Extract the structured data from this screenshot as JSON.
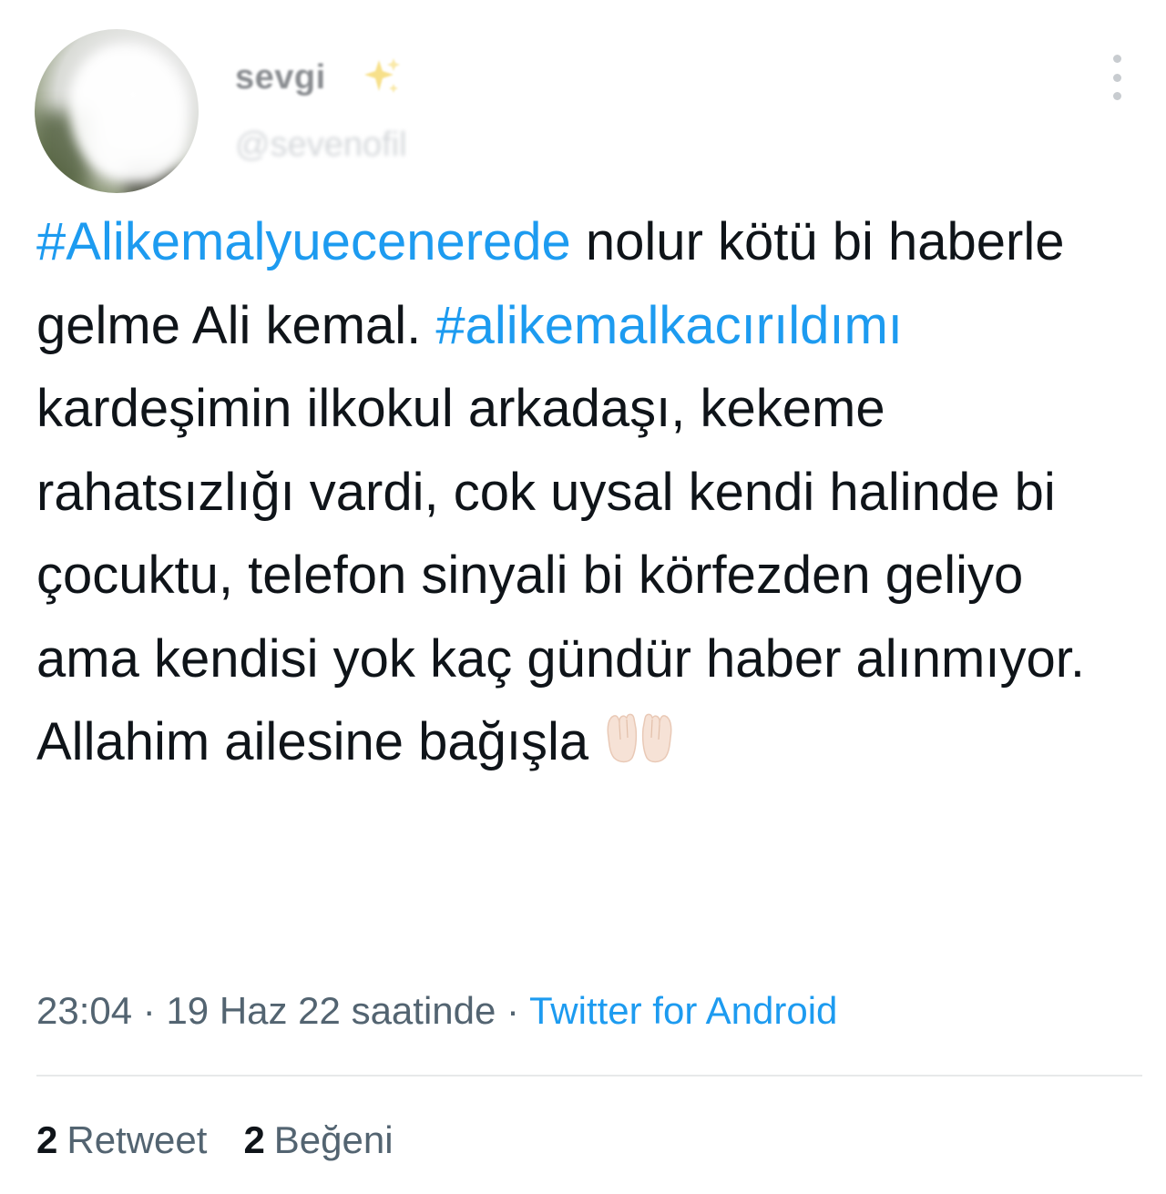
{
  "user": {
    "display_name": "sevgi",
    "handle": "@sevenofil",
    "name_icon": "sparkles-icon"
  },
  "tweet": {
    "segments": [
      {
        "type": "hashtag",
        "text": "#Alikemalyuecenerede"
      },
      {
        "type": "text",
        "text": " nolur kötü bi haberle gelme Ali kemal. "
      },
      {
        "type": "hashtag",
        "text": "#alikemalkacırıldımı"
      },
      {
        "type": "text",
        "text": " kardeşimin ilkokul arkadaşı, kekeme rahatsızlığı vardi, cok uysal kendi halinde bi çocuktu, telefon sinyali bi körfezden geliyo ama kendisi yok kaç gündür haber alınmıyor. Allahim ailesine bağışla"
      }
    ],
    "emoji": "folded-hands-icon"
  },
  "meta": {
    "time": "23:04",
    "separator1": " · ",
    "date": "19 Haz 22 saatinde",
    "separator2": " · ",
    "source": "Twitter for Android"
  },
  "stats": {
    "retweets_count": "2",
    "retweets_label": "Retweet",
    "likes_count": "2",
    "likes_label": "Beğeni"
  },
  "colors": {
    "hashtag": "#1d9bf0",
    "text": "#0f1419",
    "secondary": "#536471",
    "divider": "#e7e9ea"
  }
}
